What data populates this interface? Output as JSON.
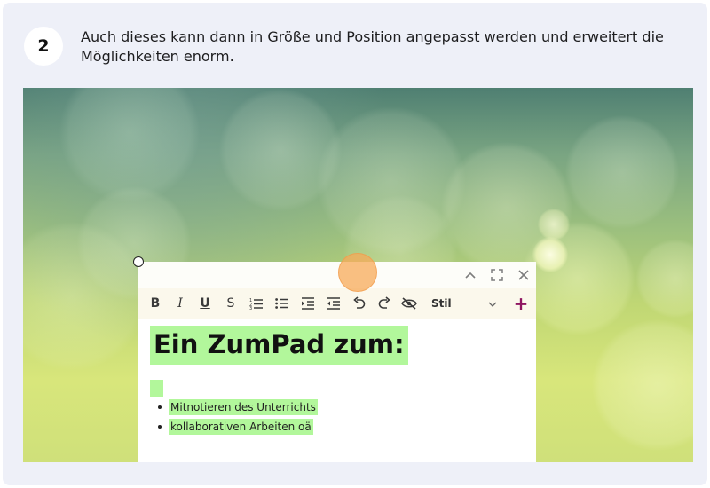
{
  "step": {
    "number": "2",
    "text": "Auch dieses kann dann in Größe und Position angepasst werden und erweitert die Möglichkeiten enorm."
  },
  "editor": {
    "window_controls": [
      "chevron-up-icon",
      "fullscreen-icon",
      "close-icon"
    ],
    "toolbar": {
      "buttons": [
        "bold",
        "italic",
        "underline",
        "strikethrough",
        "numbered-list",
        "bullet-list",
        "indent",
        "outdent",
        "undo",
        "redo",
        "hide"
      ],
      "bold_label": "B",
      "italic_label": "I",
      "underline_label": "U",
      "strike_label": "S",
      "style_select": "Stil",
      "add_label": "+"
    },
    "document": {
      "title": "Ein ZumPad zum:",
      "list_items": [
        "Mitnotieren des Unterrichts",
        "kollaborativen Arbeiten oä"
      ],
      "highlight_color": "#b2f79b"
    }
  },
  "colors": {
    "card_background": "#eef0f8",
    "add_button": "#8e1560",
    "drag_indicator": "#f7aa58"
  }
}
